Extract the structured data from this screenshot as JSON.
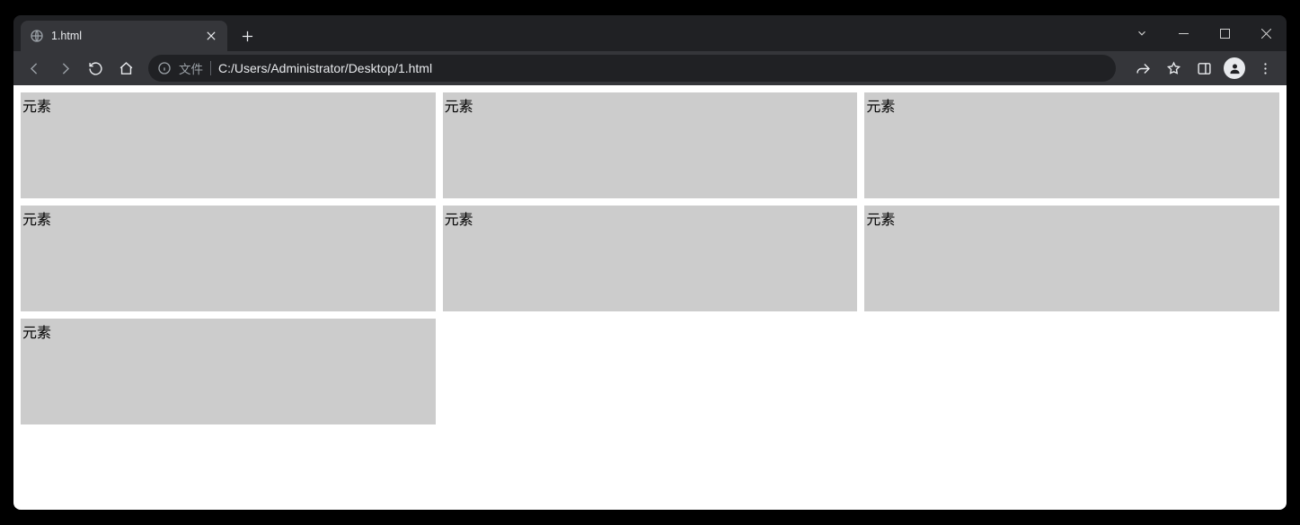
{
  "browser": {
    "tab_title": "1.html",
    "address_scheme_label": "文件",
    "url": "C:/Users/Administrator/Desktop/1.html"
  },
  "page": {
    "cards": [
      {
        "label": "元素"
      },
      {
        "label": "元素"
      },
      {
        "label": "元素"
      },
      {
        "label": "元素"
      },
      {
        "label": "元素"
      },
      {
        "label": "元素"
      },
      {
        "label": "元素"
      }
    ]
  }
}
